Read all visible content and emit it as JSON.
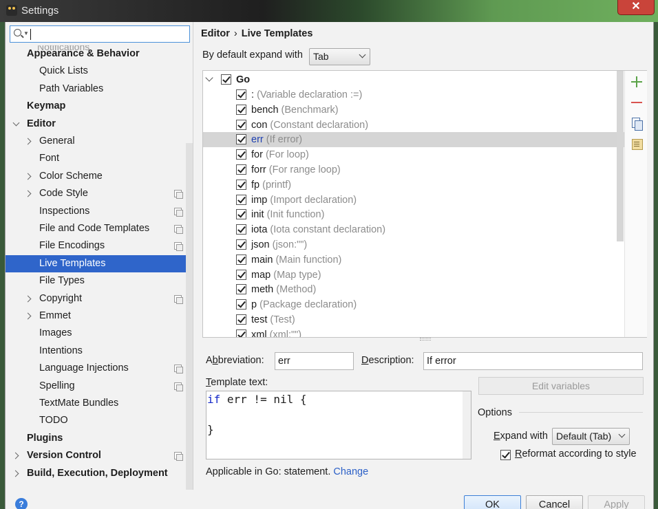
{
  "window": {
    "title": "Settings",
    "close_label": "✕"
  },
  "sidebar": {
    "search_placeholder": "",
    "partial_item": "Notifications",
    "items": [
      {
        "label": "Appearance & Behavior",
        "level": 0,
        "bold": true
      },
      {
        "label": "Quick Lists",
        "level": 1
      },
      {
        "label": "Path Variables",
        "level": 1
      },
      {
        "label": "Keymap",
        "level": 0,
        "bold": true
      },
      {
        "label": "Editor",
        "level": 0,
        "bold": true,
        "expanded": true
      },
      {
        "label": "General",
        "level": 1,
        "expandable": true
      },
      {
        "label": "Font",
        "level": 1
      },
      {
        "label": "Color Scheme",
        "level": 1,
        "expandable": true
      },
      {
        "label": "Code Style",
        "level": 1,
        "expandable": true,
        "project": true
      },
      {
        "label": "Inspections",
        "level": 1,
        "project": true
      },
      {
        "label": "File and Code Templates",
        "level": 1,
        "project": true
      },
      {
        "label": "File Encodings",
        "level": 1,
        "project": true
      },
      {
        "label": "Live Templates",
        "level": 1,
        "selected": true
      },
      {
        "label": "File Types",
        "level": 1
      },
      {
        "label": "Copyright",
        "level": 1,
        "expandable": true,
        "project": true
      },
      {
        "label": "Emmet",
        "level": 1,
        "expandable": true
      },
      {
        "label": "Images",
        "level": 1
      },
      {
        "label": "Intentions",
        "level": 1
      },
      {
        "label": "Language Injections",
        "level": 1,
        "project": true
      },
      {
        "label": "Spelling",
        "level": 1,
        "project": true
      },
      {
        "label": "TextMate Bundles",
        "level": 1
      },
      {
        "label": "TODO",
        "level": 1
      },
      {
        "label": "Plugins",
        "level": 0,
        "bold": true
      },
      {
        "label": "Version Control",
        "level": 0,
        "bold": true,
        "expandable": true,
        "project": true
      },
      {
        "label": "Build, Execution, Deployment",
        "level": 0,
        "bold": true,
        "expandable": true
      }
    ]
  },
  "breadcrumb": {
    "parent": "Editor",
    "separator": "›",
    "current": "Live Templates"
  },
  "expand": {
    "label": "By default expand with",
    "value": "Tab"
  },
  "templates": {
    "group": "Go",
    "items": [
      {
        "abbr": ":",
        "desc": "(Variable declaration :=)"
      },
      {
        "abbr": "bench",
        "desc": "(Benchmark)"
      },
      {
        "abbr": "con",
        "desc": "(Constant declaration)"
      },
      {
        "abbr": "err",
        "desc": "(If error)",
        "selected": true
      },
      {
        "abbr": "for",
        "desc": "(For loop)"
      },
      {
        "abbr": "forr",
        "desc": "(For range loop)"
      },
      {
        "abbr": "fp",
        "desc": "(printf)"
      },
      {
        "abbr": "imp",
        "desc": "(Import declaration)"
      },
      {
        "abbr": "init",
        "desc": "(Init function)"
      },
      {
        "abbr": "iota",
        "desc": "(Iota constant declaration)"
      },
      {
        "abbr": "json",
        "desc": "(json:\"\")"
      },
      {
        "abbr": "main",
        "desc": "(Main function)"
      },
      {
        "abbr": "map",
        "desc": "(Map type)"
      },
      {
        "abbr": "meth",
        "desc": "(Method)"
      },
      {
        "abbr": "p",
        "desc": "(Package declaration)"
      },
      {
        "abbr": "test",
        "desc": "(Test)"
      },
      {
        "abbr": "xml",
        "desc": "(xml:\"\")"
      }
    ]
  },
  "detail": {
    "abbreviation_label_pre": "A",
    "abbreviation_label_u": "b",
    "abbreviation_label_post": "breviation:",
    "abbreviation_value": "err",
    "description_label_u": "D",
    "description_label_post": "escription:",
    "description_value": "If error",
    "template_text_label_u": "T",
    "template_text_label_post": "emplate text:",
    "code_keyword": "if",
    "code_line1_rest": " err != nil {",
    "code_line3": "}",
    "edit_variables": "Edit variables",
    "options_title": "Options",
    "expand_with_label_u": "E",
    "expand_with_label_post": "xpand with",
    "expand_with_value": "Default (Tab)",
    "reformat_label_u": "R",
    "reformat_label_post": "eformat according to style",
    "applicable_text": "Applicable in Go: statement.",
    "change_link": "Change"
  },
  "buttons": {
    "ok": "OK",
    "cancel": "Cancel",
    "apply": "Apply"
  },
  "help_label": "?"
}
